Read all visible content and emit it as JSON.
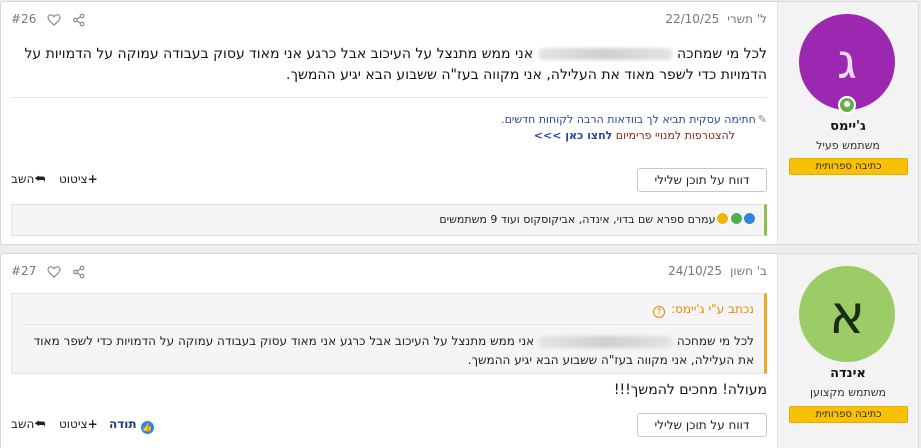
{
  "colors": {
    "accent": "#9c27b0",
    "avatar2": "#9ccc65",
    "banner": "#f9c106",
    "quote_bar": "#f5a623",
    "reaction_bar": "#8bc34a"
  },
  "posts": [
    {
      "user": {
        "initial": "ג",
        "name": "ג'יימס",
        "title": "משתמש פעיל",
        "banner": "כתיבה ספרותית",
        "online": true
      },
      "date_label": "ל' תשרי",
      "date": "22/10/25",
      "number": "#26",
      "body_part1": "לכל מי שמחכה",
      "body_part2": "אני ממש מתנצל על העיכוב אבל כרגע אני מאוד עסוק בעבודה עמוקה על הדמויות על הדמויות כדי לשפר מאוד את העלילה, אני מקווה בעז\"ה ששבוע הבא יגיע ההמשך.",
      "signature": {
        "line1": "חתימה עסקית תביא לך בוודאות הרבה לקוחות חדשים.",
        "line2": "להצטרפות למנויי פרימיום",
        "link": "לחצו כאן >>>"
      },
      "report": "דווח על תוכן שלילי",
      "quote_action": "ציטוט",
      "reply_action": "השב",
      "reactions_text": "עמרם ספרא שם בדוי, אינדה, אביקוסקוס ועוד 9 משתמשים"
    },
    {
      "user": {
        "initial": "א",
        "name": "אינדה",
        "title": "משתמש מקצוען",
        "banner": "כתיבה ספרותית"
      },
      "date_label": "ב' חשון",
      "date": "24/10/25",
      "number": "#27",
      "quote_author": "נכתב ע\"י ג'יימס:",
      "quote_part1": "לכל מי שמחכה",
      "quote_part2": "אני ממש מתנצל על העיכוב אבל כרגע אני מאוד עסוק בעבודה עמוקה על הדמויות כדי לשפר מאוד את העלילה, אני מקווה בעז\"ה ששבוע הבא יגיע ההמשך.",
      "body": "מעולה! מחכים להמשך!!!",
      "report": "דווח על תוכן שלילי",
      "thanks_action": "תודה",
      "quote_action": "ציטוט",
      "reply_action": "השב"
    }
  ]
}
